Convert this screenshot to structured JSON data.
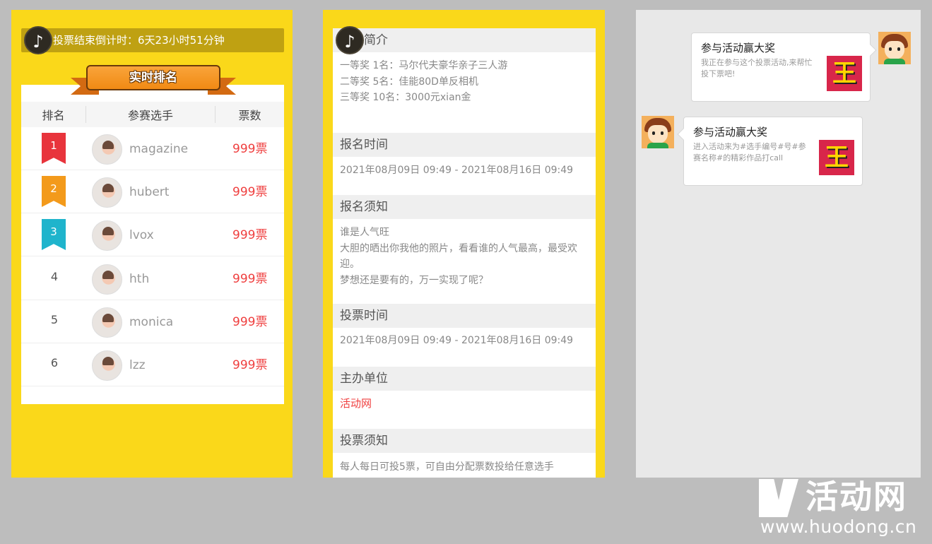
{
  "ranking_panel": {
    "countdown": "投票结束倒计时：6天23小时51分钟",
    "music_icon": "♪",
    "banner_title": "实时排名",
    "headers": {
      "rank": "排名",
      "player": "参赛选手",
      "votes": "票数"
    },
    "rows": [
      {
        "rank": "1",
        "name": "magazine",
        "votes": "999票",
        "medal_color": "#e8343c"
      },
      {
        "rank": "2",
        "name": "hubert",
        "votes": "999票",
        "medal_color": "#f39a1b"
      },
      {
        "rank": "3",
        "name": "lvox",
        "votes": "999票",
        "medal_color": "#1fb4cc"
      },
      {
        "rank": "4",
        "name": "hth",
        "votes": "999票"
      },
      {
        "rank": "5",
        "name": "monica",
        "votes": "999票"
      },
      {
        "rank": "6",
        "name": "lzz",
        "votes": "999票"
      }
    ]
  },
  "detail_panel": {
    "music_icon": "♪",
    "sections": [
      {
        "title": "活动简介",
        "lines": [
          "一等奖 1名：马尔代夫豪华亲子三人游",
          "二等奖 5名：佳能80D单反相机",
          "三等奖 10名：3000元xian金"
        ]
      },
      {
        "title": "报名时间",
        "lines": [
          "2021年08月09日 09:49 - 2021年08月16日 09:49"
        ]
      },
      {
        "title": "报名须知",
        "lines": [
          "谁是人气旺",
          "大胆的晒出你我他的照片，看看谁的人气最高，最受欢迎。",
          "梦想还是要有的，万一实现了呢？"
        ]
      },
      {
        "title": "投票时间",
        "lines": [
          "2021年08月09日 09:49 - 2021年08月16日 09:49"
        ]
      },
      {
        "title": "主办单位",
        "lines": [
          "活动网"
        ],
        "highlight": true
      },
      {
        "title": "投票须知",
        "lines": [
          "每人每日可投5票，可自由分配票数投给任意选手"
        ]
      }
    ]
  },
  "share_panel": {
    "messages": [
      {
        "title": "参与活动赢大奖",
        "desc": "我正在参与这个投票活动,来帮忙投下票吧!",
        "thumb_char": "王"
      },
      {
        "title": "参与活动赢大奖",
        "desc": "进入活动来为#选手编号#号#参赛名称#的精彩作品打call",
        "thumb_char": "王"
      }
    ]
  },
  "watermark": {
    "brand": "活动网",
    "url": "www.huodong.cn"
  }
}
